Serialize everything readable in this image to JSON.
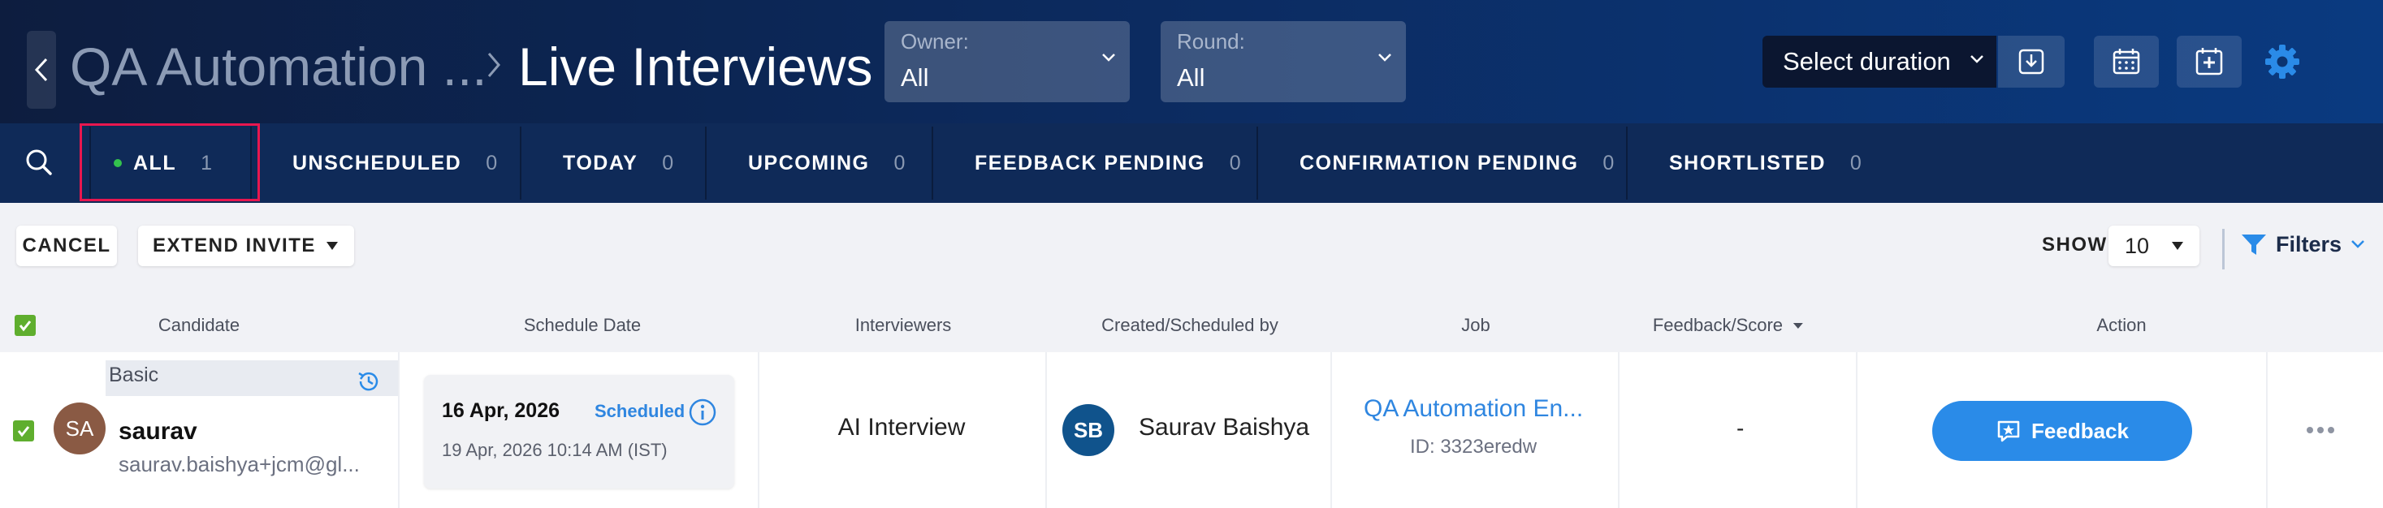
{
  "header": {
    "breadcrumb_parent": "QA Automation ...",
    "title": "Live Interviews",
    "owner": {
      "label": "Owner:",
      "value": "All"
    },
    "round": {
      "label": "Round:",
      "value": "All"
    },
    "duration_label": "Select duration"
  },
  "tabs": [
    {
      "label": "ALL",
      "count": "1",
      "active": true
    },
    {
      "label": "UNSCHEDULED",
      "count": "0"
    },
    {
      "label": "TODAY",
      "count": "0"
    },
    {
      "label": "UPCOMING",
      "count": "0"
    },
    {
      "label": "FEEDBACK PENDING",
      "count": "0"
    },
    {
      "label": "CONFIRMATION PENDING",
      "count": "0"
    },
    {
      "label": "SHORTLISTED",
      "count": "0"
    }
  ],
  "toolbar": {
    "cancel_label": "CANCEL",
    "extend_label": "EXTEND INVITE",
    "show_label": "SHOW",
    "show_value": "10",
    "filters_label": "Filters"
  },
  "table": {
    "columns": {
      "candidate": "Candidate",
      "schedule": "Schedule Date",
      "interviewers": "Interviewers",
      "created": "Created/Scheduled by",
      "job": "Job",
      "feedback": "Feedback/Score",
      "action": "Action"
    },
    "row": {
      "tag": "Basic",
      "initials": "SA",
      "name": "saurav",
      "email": "saurav.baishya+jcm@gl...",
      "date": "16 Apr, 2026",
      "status": "Scheduled",
      "scheduled_at": "19 Apr, 2026 10:14 AM (IST)",
      "interviewer": "AI Interview",
      "creator_initials": "SB",
      "creator": "Saurav Baishya",
      "job_title": "QA Automation En...",
      "job_id": "ID: 3323eredw",
      "feedback_score": "-",
      "action_label": "Feedback"
    }
  },
  "colors": {
    "accent": "#2a8be8",
    "header_bg": "#0c2a5e",
    "tabbar_bg": "#0f2a58",
    "check": "#5fae2e",
    "highlight": "#e8174f"
  }
}
